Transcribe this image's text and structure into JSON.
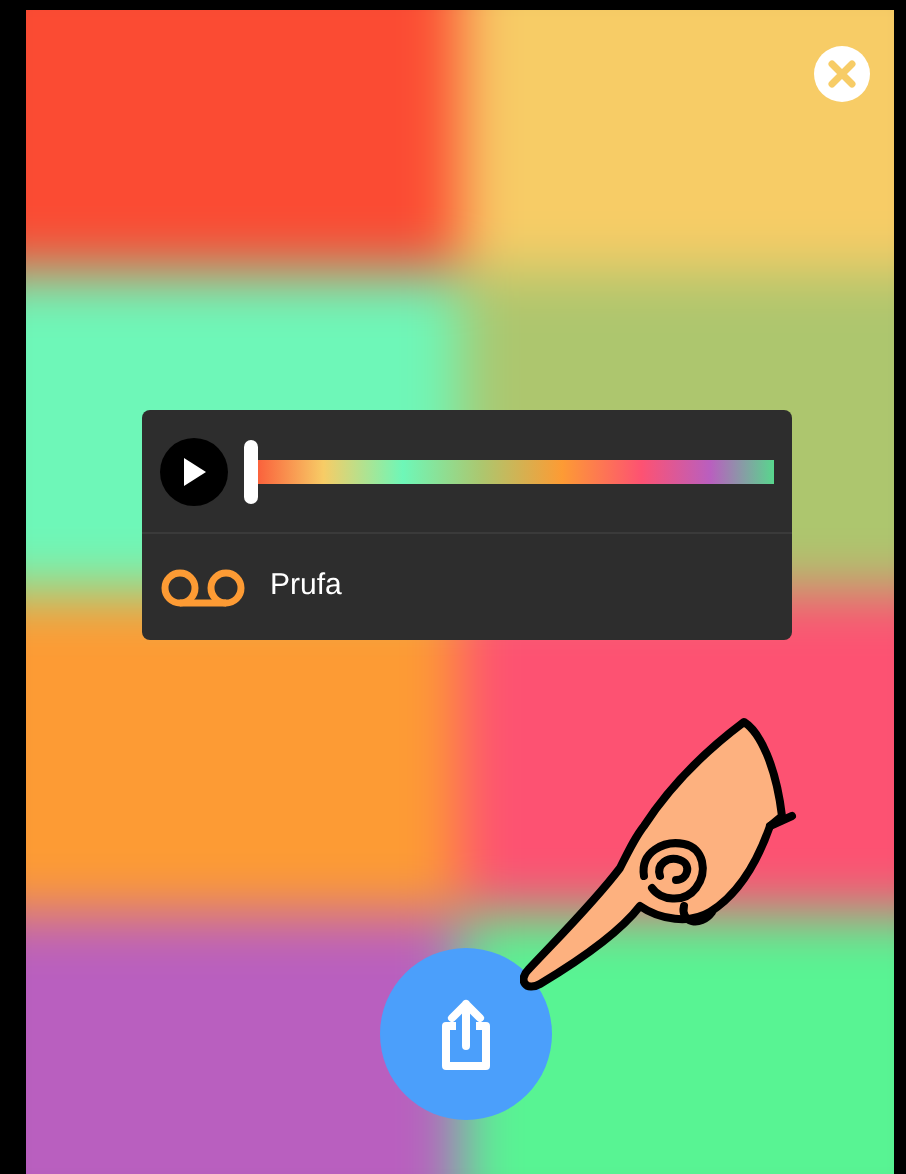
{
  "player": {
    "playing": false,
    "level": 0,
    "label": "Prufa"
  }
}
